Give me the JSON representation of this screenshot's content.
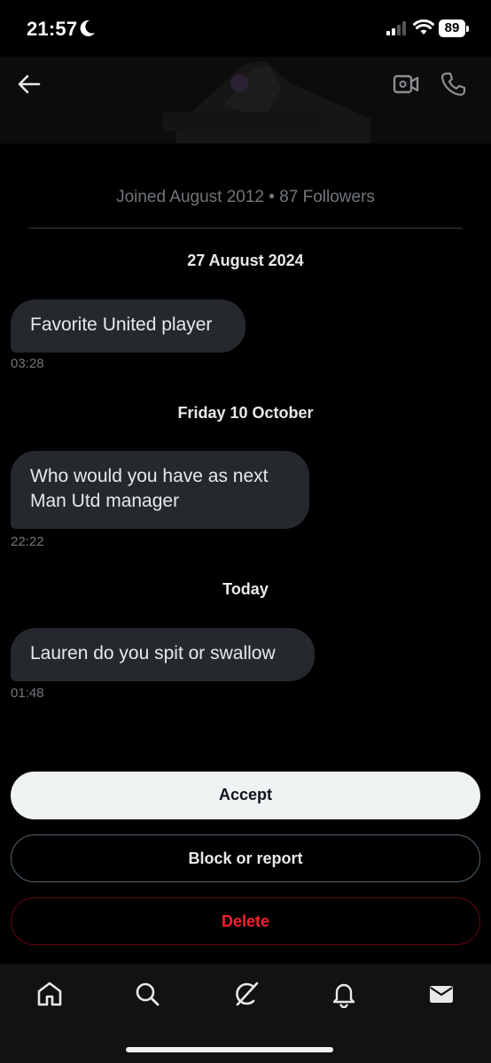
{
  "status_bar": {
    "time": "21:57",
    "battery": "89"
  },
  "header": {
    "back_icon": "arrow-left-icon",
    "video_icon": "video-camera-icon",
    "call_icon": "phone-icon"
  },
  "profile": {
    "joined_text": "Joined August 2012 • 87 Followers"
  },
  "conversation": [
    {
      "date": "27 August 2024",
      "messages": [
        {
          "lines": [
            "Favorite United player"
          ],
          "time": "03:28"
        }
      ]
    },
    {
      "date": "Friday 10 October",
      "messages": [
        {
          "lines": [
            "Who would you have as next",
            "Man Utd manager"
          ],
          "time": "22:22"
        }
      ]
    },
    {
      "date": "Today",
      "messages": [
        {
          "lines": [
            "Lauren do you spit or swallow"
          ],
          "time": "01:48"
        }
      ]
    }
  ],
  "actions": {
    "accept": "Accept",
    "block_report": "Block or report",
    "delete": "Delete"
  },
  "tabbar": {
    "items": [
      "home-icon",
      "search-icon",
      "grok-icon",
      "notifications-bell-icon",
      "messages-envelope-icon"
    ],
    "active": "messages-envelope-icon"
  },
  "colors": {
    "background": "#000000",
    "bubble": "#25292e",
    "muted_text": "#71767b",
    "delete_red": "#f4212e",
    "accept_bg": "#eff3f4"
  }
}
